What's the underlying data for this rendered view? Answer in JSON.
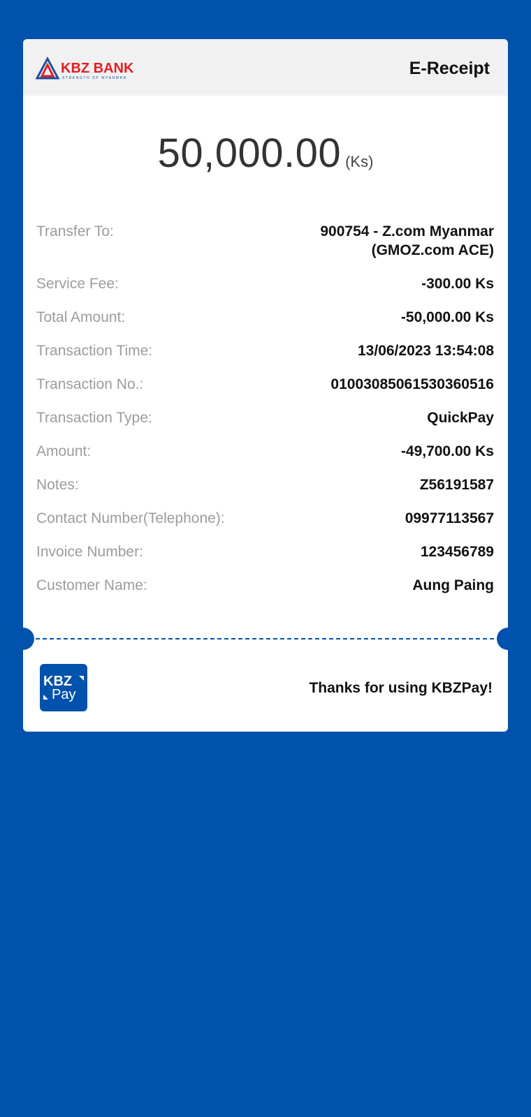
{
  "header": {
    "brand": "KBZ BANK",
    "tagline": "STRENGTH OF MYANMAR",
    "title": "E-Receipt"
  },
  "amount": {
    "value": "50,000.00",
    "unit": "(Ks)"
  },
  "details": {
    "transfer_to": {
      "label": "Transfer To:",
      "value_line1": "900754 - Z.com Myanmar",
      "value_line2": "(GMOZ.com ACE)"
    },
    "service_fee": {
      "label": "Service Fee:",
      "value": "-300.00 Ks"
    },
    "total_amount": {
      "label": "Total Amount:",
      "value": "-50,000.00 Ks"
    },
    "transaction_time": {
      "label": "Transaction Time:",
      "value": "13/06/2023 13:54:08"
    },
    "transaction_no": {
      "label": "Transaction No.:",
      "value": "01003085061530360516"
    },
    "transaction_type": {
      "label": "Transaction Type:",
      "value": "QuickPay"
    },
    "amount": {
      "label": "Amount:",
      "value": "-49,700.00 Ks"
    },
    "notes": {
      "label": "Notes:",
      "value": "Z56191587"
    },
    "contact_number": {
      "label": "Contact Number(Telephone):",
      "value": "09977113567"
    },
    "invoice_number": {
      "label": "Invoice Number:",
      "value": "123456789"
    },
    "customer_name": {
      "label": "Customer Name:",
      "value": "Aung Paing"
    }
  },
  "footer": {
    "logo_text_top": "KBZ",
    "logo_text_bottom": "Pay",
    "thanks": "Thanks for using KBZPay!"
  },
  "colors": {
    "background": "#0052ac",
    "brand_red": "#e31e24",
    "brand_blue": "#1d4fa0",
    "label_gray": "#9c9c9c"
  }
}
